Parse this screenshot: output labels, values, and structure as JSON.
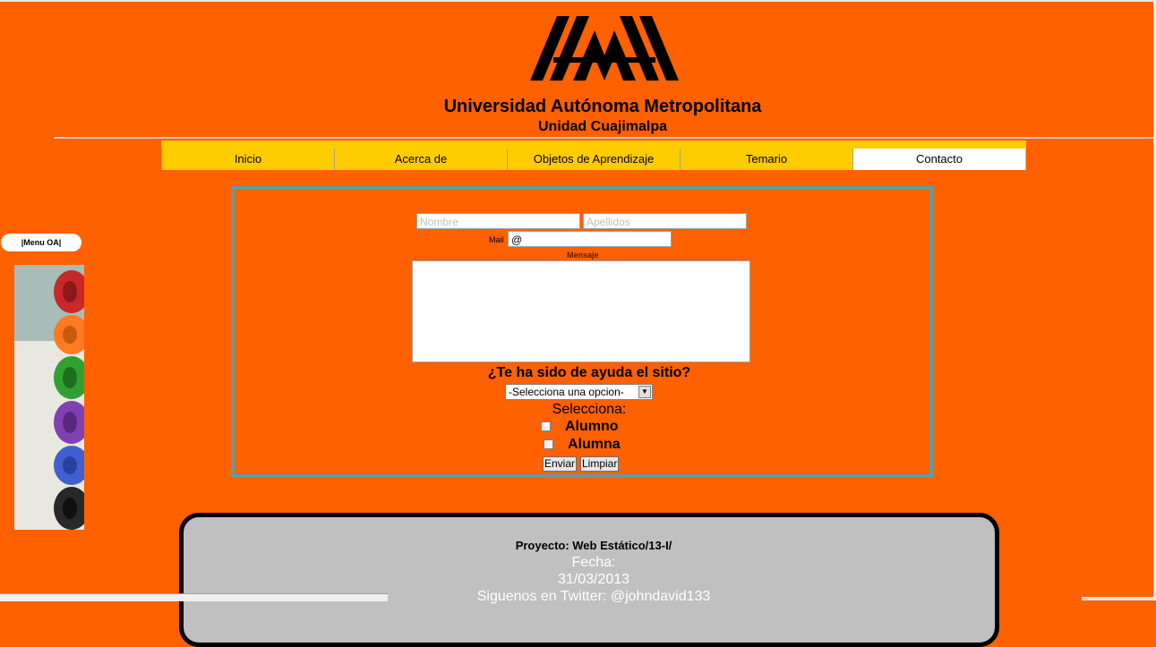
{
  "header": {
    "university": "Universidad Autónoma Metropolitana",
    "unit": "Unidad Cuajimalpa"
  },
  "nav": {
    "items": [
      {
        "label": "Inicio"
      },
      {
        "label": "Acerca de"
      },
      {
        "label": "Objetos de Aprendizaje"
      },
      {
        "label": "Temario"
      },
      {
        "label": "Contacto",
        "active": true
      }
    ]
  },
  "side": {
    "menu_label": "|Menu OA|"
  },
  "form": {
    "nombre_placeholder": "Nombre",
    "apellidos_placeholder": "Apellidos",
    "mail_label": "Mail",
    "mail_value": "@",
    "mensaje_label": "Mensaje",
    "question": "¿Te ha sido de ayuda el sitio?",
    "select_value": "-Selecciona una opcion-",
    "selecciona_label": "Selecciona:",
    "checkbox_alumno": "Alumno",
    "checkbox_alumna": "Alumna",
    "submit_label": "Enviar",
    "reset_label": "Limpiar"
  },
  "footer": {
    "project": "Proyecto: Web Estático/13-I/",
    "fecha_label": "Fecha:",
    "fecha": "31/03/2013",
    "twitter": "Siguenos en Twitter: @johndavid133"
  },
  "colors": {
    "background": "#ff6000",
    "nav": "#ffcc00",
    "form_border": "#5aa0a0",
    "footer": "#c0c0c0"
  }
}
